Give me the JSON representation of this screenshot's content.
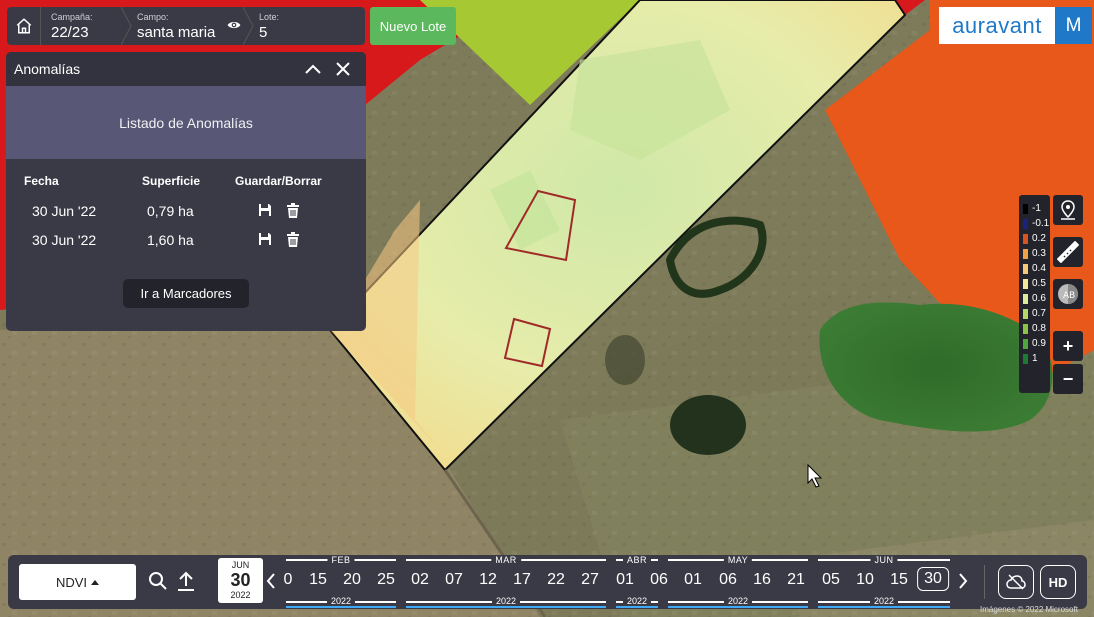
{
  "topbar": {
    "campana_label": "Campaña:",
    "campana_value": "22/23",
    "campo_label": "Campo:",
    "campo_value": "santa maria",
    "lote_label": "Lote:",
    "lote_value": "5",
    "nuevo_lote": "Nuevo Lote"
  },
  "brand": {
    "logo_text": "auravant",
    "user_initial": "M",
    "color": "#1f78c8"
  },
  "panel": {
    "title": "Anomalías",
    "subtitle": "Listado de Anomalías",
    "columns": [
      "Fecha",
      "Superficie",
      "Guardar/Borrar"
    ],
    "rows": [
      {
        "fecha": "30 Jun '22",
        "superficie": "0,79 ha"
      },
      {
        "fecha": "30 Jun '22",
        "superficie": "1,60 ha"
      }
    ],
    "button": "Ir a Marcadores"
  },
  "legend": [
    {
      "label": "-1",
      "color": "#000000"
    },
    {
      "label": "-0.1",
      "color": "#1a237e"
    },
    {
      "label": "0.2",
      "color": "#d9541e"
    },
    {
      "label": "0.3",
      "color": "#f0a045"
    },
    {
      "label": "0.4",
      "color": "#f5c87a"
    },
    {
      "label": "0.5",
      "color": "#f3e79b"
    },
    {
      "label": "0.6",
      "color": "#dcea9a"
    },
    {
      "label": "0.7",
      "color": "#b5d86b"
    },
    {
      "label": "0.8",
      "color": "#8cc24a"
    },
    {
      "label": "0.9",
      "color": "#4fa83c"
    },
    {
      "label": "1",
      "color": "#1e7b34"
    }
  ],
  "zoom": {
    "in": "+",
    "out": "−"
  },
  "bottombar": {
    "layer_button": "NDVI",
    "selected_date": {
      "month": "JUN",
      "day": "30",
      "year": "2022"
    },
    "days": [
      "0",
      "15",
      "20",
      "25",
      "02",
      "07",
      "12",
      "17",
      "22",
      "27",
      "01",
      "06",
      "01",
      "06",
      "16",
      "21",
      "05",
      "10",
      "15",
      "30"
    ],
    "months": [
      "FEB",
      "MAR",
      "ABR",
      "MAY",
      "JUN"
    ],
    "years": [
      "2022",
      "2022",
      "2022",
      "2022",
      "2022"
    ],
    "hd": "HD"
  },
  "copyright": "Imágenes © 2022 Microsoft"
}
